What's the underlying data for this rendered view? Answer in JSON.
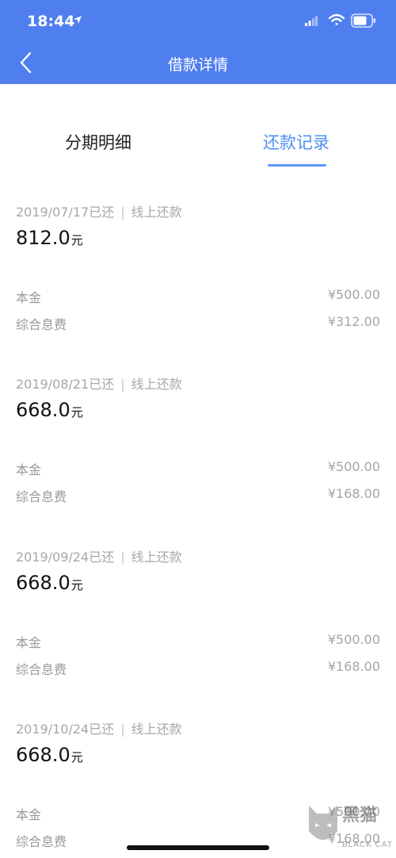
{
  "status_bar": {
    "time": "18:44"
  },
  "nav": {
    "title": "借款详情"
  },
  "tabs": [
    {
      "label": "分期明细",
      "active": false
    },
    {
      "label": "还款记录",
      "active": true
    }
  ],
  "records": [
    {
      "date": "2019/07/17已还",
      "method": "线上还款",
      "amount": "812.0",
      "unit": "元",
      "principal_label": "本金",
      "principal": "¥500.00",
      "fee_label": "综合息费",
      "fee": "¥312.00"
    },
    {
      "date": "2019/08/21已还",
      "method": "线上还款",
      "amount": "668.0",
      "unit": "元",
      "principal_label": "本金",
      "principal": "¥500.00",
      "fee_label": "综合息费",
      "fee": "¥168.00"
    },
    {
      "date": "2019/09/24已还",
      "method": "线上还款",
      "amount": "668.0",
      "unit": "元",
      "principal_label": "本金",
      "principal": "¥500.00",
      "fee_label": "综合息费",
      "fee": "¥168.00"
    },
    {
      "date": "2019/10/24已还",
      "method": "线上还款",
      "amount": "668.0",
      "unit": "元",
      "principal_label": "本金",
      "principal": "¥500.00",
      "fee_label": "综合息费",
      "fee": "¥168.00"
    }
  ],
  "watermark": {
    "cn": "黑猫",
    "en": "BLACK CAT"
  },
  "colors": {
    "accent": "#4f7fef",
    "tab_active": "#4f90f0"
  }
}
